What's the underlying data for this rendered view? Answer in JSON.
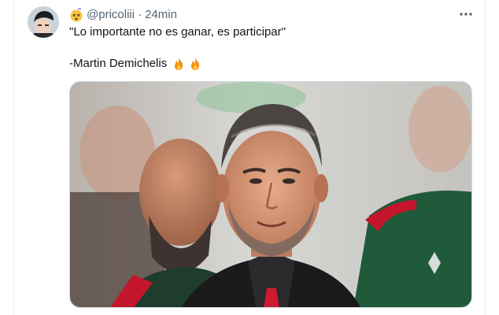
{
  "tweet": {
    "handle": "@pricoliii",
    "separator": "·",
    "time": "24min",
    "text_line1": "\"Lo importante no es ganar, es participar\"",
    "text_line2": "-Martin Demichelis"
  },
  "icons": {
    "author_badge": "dizzy-face-emoji",
    "more": "more-dots-icon",
    "fire": "fire-emoji"
  },
  "colors": {
    "text_primary": "#0f1419",
    "text_secondary": "#536471",
    "border": "#cfd9de",
    "shirt_red": "#c3162c",
    "kit_green": "#1f5a3a"
  }
}
